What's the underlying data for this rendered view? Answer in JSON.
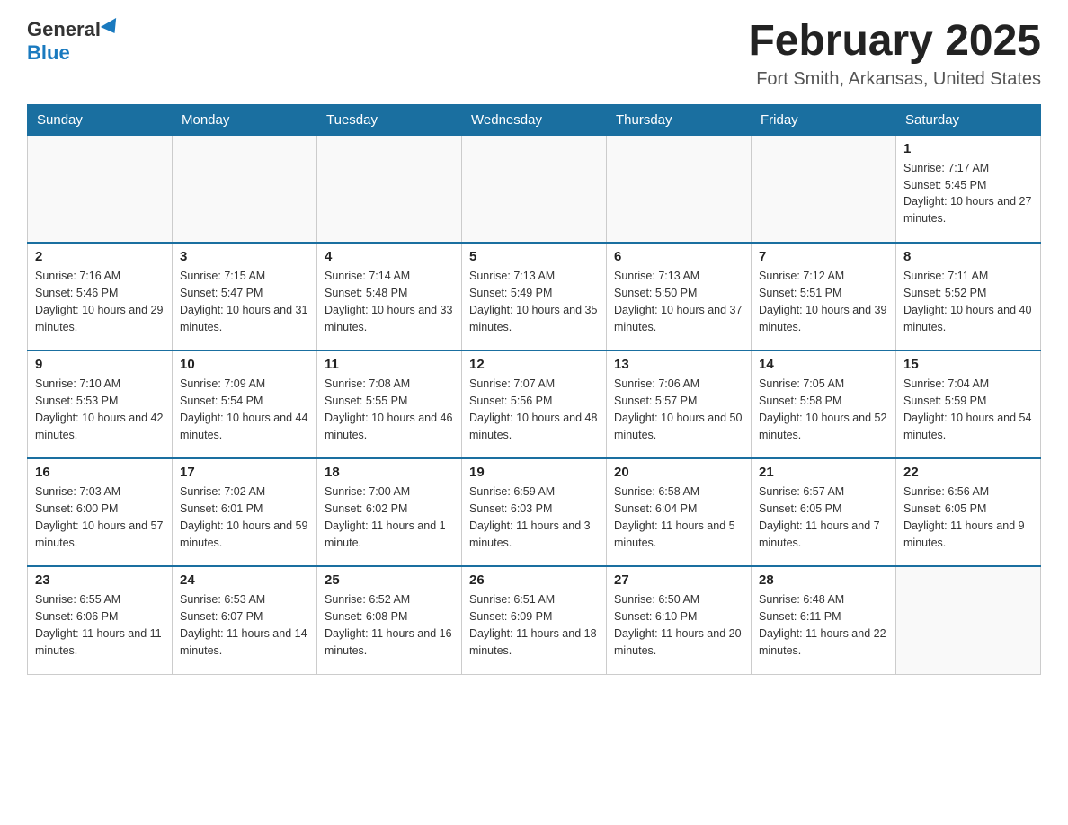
{
  "header": {
    "logo_general": "General",
    "logo_blue": "Blue",
    "main_title": "February 2025",
    "subtitle": "Fort Smith, Arkansas, United States"
  },
  "days_of_week": [
    "Sunday",
    "Monday",
    "Tuesday",
    "Wednesday",
    "Thursday",
    "Friday",
    "Saturday"
  ],
  "weeks": [
    [
      {
        "day": "",
        "info": ""
      },
      {
        "day": "",
        "info": ""
      },
      {
        "day": "",
        "info": ""
      },
      {
        "day": "",
        "info": ""
      },
      {
        "day": "",
        "info": ""
      },
      {
        "day": "",
        "info": ""
      },
      {
        "day": "1",
        "info": "Sunrise: 7:17 AM\nSunset: 5:45 PM\nDaylight: 10 hours and 27 minutes."
      }
    ],
    [
      {
        "day": "2",
        "info": "Sunrise: 7:16 AM\nSunset: 5:46 PM\nDaylight: 10 hours and 29 minutes."
      },
      {
        "day": "3",
        "info": "Sunrise: 7:15 AM\nSunset: 5:47 PM\nDaylight: 10 hours and 31 minutes."
      },
      {
        "day": "4",
        "info": "Sunrise: 7:14 AM\nSunset: 5:48 PM\nDaylight: 10 hours and 33 minutes."
      },
      {
        "day": "5",
        "info": "Sunrise: 7:13 AM\nSunset: 5:49 PM\nDaylight: 10 hours and 35 minutes."
      },
      {
        "day": "6",
        "info": "Sunrise: 7:13 AM\nSunset: 5:50 PM\nDaylight: 10 hours and 37 minutes."
      },
      {
        "day": "7",
        "info": "Sunrise: 7:12 AM\nSunset: 5:51 PM\nDaylight: 10 hours and 39 minutes."
      },
      {
        "day": "8",
        "info": "Sunrise: 7:11 AM\nSunset: 5:52 PM\nDaylight: 10 hours and 40 minutes."
      }
    ],
    [
      {
        "day": "9",
        "info": "Sunrise: 7:10 AM\nSunset: 5:53 PM\nDaylight: 10 hours and 42 minutes."
      },
      {
        "day": "10",
        "info": "Sunrise: 7:09 AM\nSunset: 5:54 PM\nDaylight: 10 hours and 44 minutes."
      },
      {
        "day": "11",
        "info": "Sunrise: 7:08 AM\nSunset: 5:55 PM\nDaylight: 10 hours and 46 minutes."
      },
      {
        "day": "12",
        "info": "Sunrise: 7:07 AM\nSunset: 5:56 PM\nDaylight: 10 hours and 48 minutes."
      },
      {
        "day": "13",
        "info": "Sunrise: 7:06 AM\nSunset: 5:57 PM\nDaylight: 10 hours and 50 minutes."
      },
      {
        "day": "14",
        "info": "Sunrise: 7:05 AM\nSunset: 5:58 PM\nDaylight: 10 hours and 52 minutes."
      },
      {
        "day": "15",
        "info": "Sunrise: 7:04 AM\nSunset: 5:59 PM\nDaylight: 10 hours and 54 minutes."
      }
    ],
    [
      {
        "day": "16",
        "info": "Sunrise: 7:03 AM\nSunset: 6:00 PM\nDaylight: 10 hours and 57 minutes."
      },
      {
        "day": "17",
        "info": "Sunrise: 7:02 AM\nSunset: 6:01 PM\nDaylight: 10 hours and 59 minutes."
      },
      {
        "day": "18",
        "info": "Sunrise: 7:00 AM\nSunset: 6:02 PM\nDaylight: 11 hours and 1 minute."
      },
      {
        "day": "19",
        "info": "Sunrise: 6:59 AM\nSunset: 6:03 PM\nDaylight: 11 hours and 3 minutes."
      },
      {
        "day": "20",
        "info": "Sunrise: 6:58 AM\nSunset: 6:04 PM\nDaylight: 11 hours and 5 minutes."
      },
      {
        "day": "21",
        "info": "Sunrise: 6:57 AM\nSunset: 6:05 PM\nDaylight: 11 hours and 7 minutes."
      },
      {
        "day": "22",
        "info": "Sunrise: 6:56 AM\nSunset: 6:05 PM\nDaylight: 11 hours and 9 minutes."
      }
    ],
    [
      {
        "day": "23",
        "info": "Sunrise: 6:55 AM\nSunset: 6:06 PM\nDaylight: 11 hours and 11 minutes."
      },
      {
        "day": "24",
        "info": "Sunrise: 6:53 AM\nSunset: 6:07 PM\nDaylight: 11 hours and 14 minutes."
      },
      {
        "day": "25",
        "info": "Sunrise: 6:52 AM\nSunset: 6:08 PM\nDaylight: 11 hours and 16 minutes."
      },
      {
        "day": "26",
        "info": "Sunrise: 6:51 AM\nSunset: 6:09 PM\nDaylight: 11 hours and 18 minutes."
      },
      {
        "day": "27",
        "info": "Sunrise: 6:50 AM\nSunset: 6:10 PM\nDaylight: 11 hours and 20 minutes."
      },
      {
        "day": "28",
        "info": "Sunrise: 6:48 AM\nSunset: 6:11 PM\nDaylight: 11 hours and 22 minutes."
      },
      {
        "day": "",
        "info": ""
      }
    ]
  ]
}
